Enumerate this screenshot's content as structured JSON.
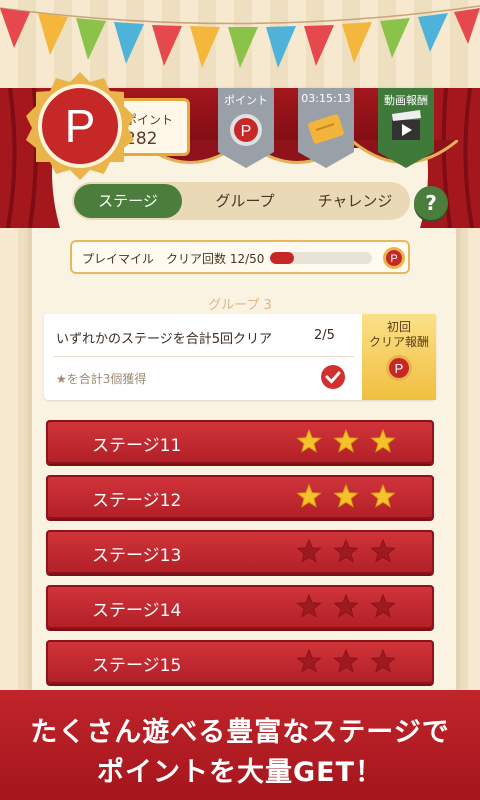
{
  "header": {
    "point_board_label": "ポイント",
    "point_board_value": "282",
    "banners": {
      "point_label": "ポイント",
      "time_label": "03:15:13",
      "video_label": "動画報酬"
    }
  },
  "tabs": [
    {
      "label": "ステージ",
      "active": true
    },
    {
      "label": "グループ",
      "active": false
    },
    {
      "label": "チャレンジ",
      "active": false
    }
  ],
  "help_label": "?",
  "play_mile": {
    "text": "プレイマイル　クリア回数 12/50",
    "progress": 0.24
  },
  "group": {
    "title": "グループ 3",
    "mission_text": "いずれかのステージを合計5回クリア",
    "mission_count": "2/5",
    "sub_mission_text": "★を合計3個獲得",
    "reward_line1": "初回",
    "reward_line2": "クリア報酬"
  },
  "stages": [
    {
      "label": "ステージ11",
      "stars": 3
    },
    {
      "label": "ステージ12",
      "stars": 3
    },
    {
      "label": "ステージ13",
      "stars": 0
    },
    {
      "label": "ステージ14",
      "stars": 0
    },
    {
      "label": "ステージ15",
      "stars": 0
    }
  ],
  "footer": {
    "line1": "たくさん遊べる豊富なステージで",
    "line2": "ポイントを大量GET！"
  },
  "colors": {
    "accent_red": "#b21f27",
    "accent_green": "#4b7d3c",
    "gold": "#f0bf3f"
  }
}
